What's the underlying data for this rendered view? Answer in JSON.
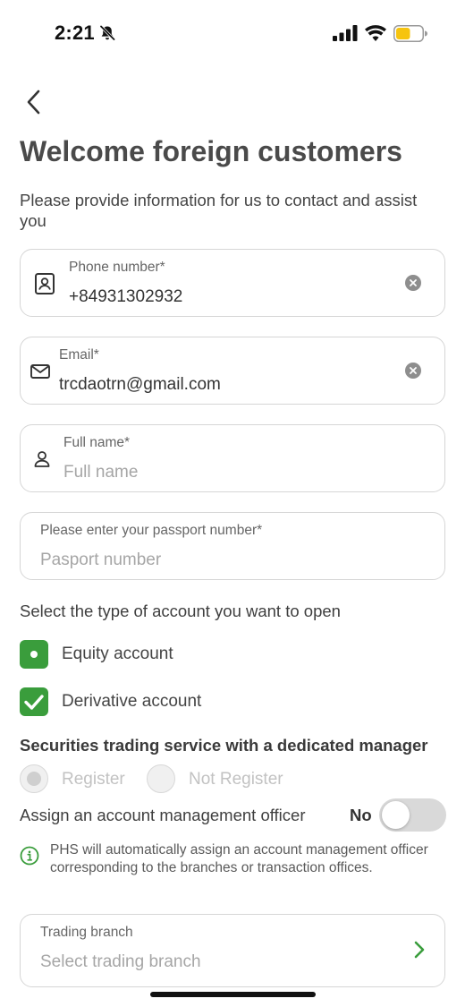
{
  "status_bar": {
    "time": "2:21",
    "icons": [
      "bell-slash-icon",
      "cellular-signal-icon",
      "wifi-icon",
      "battery-icon"
    ]
  },
  "header": {
    "back_icon": "chevron-left-icon",
    "title": "Welcome foreign customers",
    "subtitle": "Please provide information for us to contact and assist you"
  },
  "form": {
    "phone": {
      "label": "Phone number*",
      "value": "+84931302932",
      "icon": "contact-book-icon"
    },
    "email": {
      "label": "Email*",
      "value": "trcdaotrn@gmail.com",
      "icon": "envelope-icon"
    },
    "full_name": {
      "label": "Full name*",
      "placeholder": "Full name",
      "icon": "person-icon"
    },
    "passport": {
      "label": "Please enter your passport number*",
      "placeholder": "Pasport number"
    }
  },
  "account_type": {
    "heading": "Select the type of account you want to open",
    "options": [
      {
        "label": "Equity account",
        "state": "selected-dot"
      },
      {
        "label": "Derivative account",
        "state": "checked"
      }
    ]
  },
  "dedicated_manager": {
    "heading": "Securities trading service with a dedicated manager",
    "options": [
      {
        "label": "Register",
        "selected": true,
        "disabled": true
      },
      {
        "label": "Not Register",
        "selected": false,
        "disabled": true
      }
    ]
  },
  "assign_officer": {
    "label": "Assign an account management officer",
    "state_text": "No",
    "enabled": false
  },
  "info_note": {
    "icon": "info-circle-icon",
    "text": "PHS will automatically assign an account management officer corresponding to the branches or transaction offices."
  },
  "trading_branch": {
    "label": "Trading branch",
    "placeholder": "Select trading branch",
    "icon": "chevron-right-icon"
  },
  "colors": {
    "accent_green": "#3a9d3c",
    "border": "#d6d6d6",
    "battery_yellow": "#f6c40f"
  }
}
